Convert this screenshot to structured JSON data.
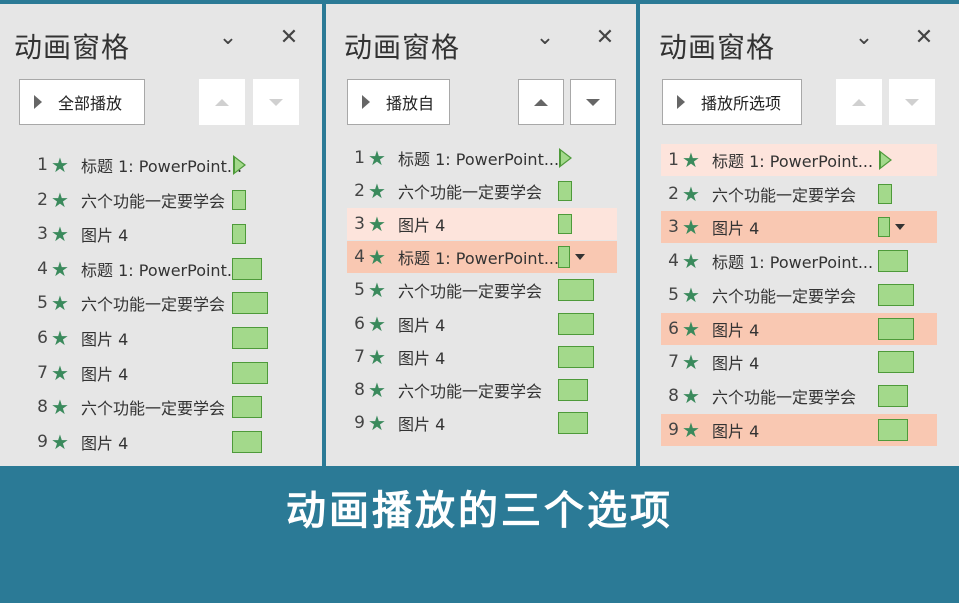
{
  "caption": "动画播放的三个选项",
  "icons": {
    "collapse": "chevron-down-icon",
    "close": "close-icon",
    "effect": "star-icon"
  },
  "colors": {
    "bar_fill": "#a3d98b",
    "bar_border": "#4e9a3a",
    "star": "#3a8a5c",
    "highlight_light": "#fde4dc",
    "highlight_strong": "#f9c8b2",
    "caption_bg": "#2b7a96"
  },
  "panels": [
    {
      "title": "动画窗格",
      "play_button": "全部播放",
      "move_up_enabled": false,
      "move_down_enabled": false,
      "items": [
        {
          "num": "1",
          "label": "标题 1: PowerPoint...",
          "timing": "play"
        },
        {
          "num": "2",
          "label": "六个功能一定要学会",
          "timing": "bar"
        },
        {
          "num": "3",
          "label": "图片 4",
          "timing": "bar"
        },
        {
          "num": "4",
          "label": "标题 1: PowerPoint...",
          "timing": "bar"
        },
        {
          "num": "5",
          "label": "六个功能一定要学会",
          "timing": "bar"
        },
        {
          "num": "6",
          "label": "图片 4",
          "timing": "bar"
        },
        {
          "num": "7",
          "label": "图片 4",
          "timing": "bar"
        },
        {
          "num": "8",
          "label": "六个功能一定要学会",
          "timing": "bar"
        },
        {
          "num": "9",
          "label": "图片 4",
          "timing": "bar"
        }
      ]
    },
    {
      "title": "动画窗格",
      "play_button": "播放自",
      "move_up_enabled": true,
      "move_down_enabled": true,
      "items": [
        {
          "num": "1",
          "label": "标题 1: PowerPoint...",
          "timing": "play"
        },
        {
          "num": "2",
          "label": "六个功能一定要学会",
          "timing": "bar"
        },
        {
          "num": "3",
          "label": "图片 4",
          "timing": "bar",
          "highlight": "light"
        },
        {
          "num": "4",
          "label": "标题 1: PowerPoint...",
          "timing": "bar",
          "highlight": "strong",
          "dropdown": true
        },
        {
          "num": "5",
          "label": "六个功能一定要学会",
          "timing": "bar"
        },
        {
          "num": "6",
          "label": "图片 4",
          "timing": "bar"
        },
        {
          "num": "7",
          "label": "图片 4",
          "timing": "bar"
        },
        {
          "num": "8",
          "label": "六个功能一定要学会",
          "timing": "bar"
        },
        {
          "num": "9",
          "label": "图片 4",
          "timing": "bar"
        }
      ]
    },
    {
      "title": "动画窗格",
      "play_button": "播放所选项",
      "move_up_enabled": false,
      "move_down_enabled": false,
      "items": [
        {
          "num": "1",
          "label": "标题 1: PowerPoint...",
          "timing": "play",
          "highlight": "light"
        },
        {
          "num": "2",
          "label": "六个功能一定要学会",
          "timing": "bar"
        },
        {
          "num": "3",
          "label": "图片 4",
          "timing": "bar",
          "highlight": "strong",
          "dropdown": true
        },
        {
          "num": "4",
          "label": "标题 1: PowerPoint...",
          "timing": "bar"
        },
        {
          "num": "5",
          "label": "六个功能一定要学会",
          "timing": "bar"
        },
        {
          "num": "6",
          "label": "图片 4",
          "timing": "bar",
          "highlight": "strong"
        },
        {
          "num": "7",
          "label": "图片 4",
          "timing": "bar"
        },
        {
          "num": "8",
          "label": "六个功能一定要学会",
          "timing": "bar"
        },
        {
          "num": "9",
          "label": "图片 4",
          "timing": "bar",
          "highlight": "strong"
        }
      ]
    }
  ]
}
